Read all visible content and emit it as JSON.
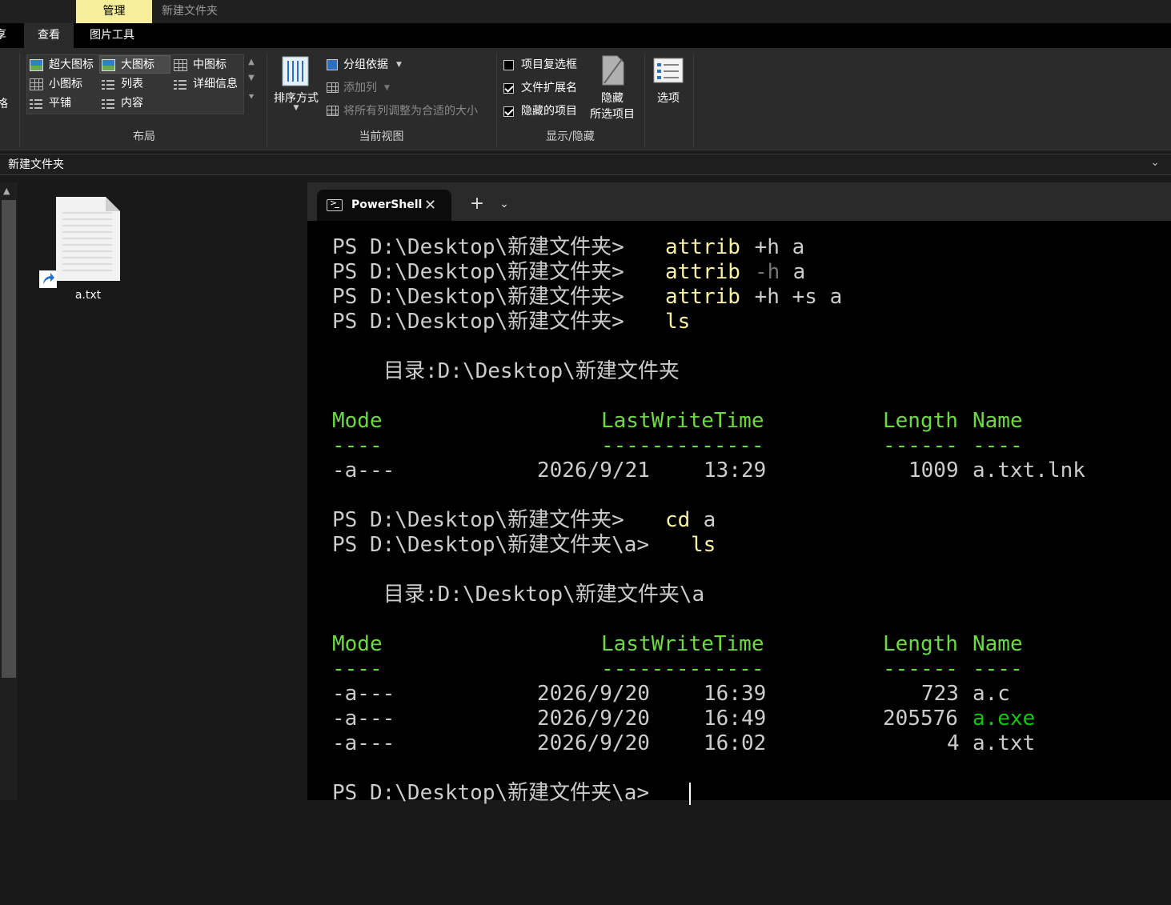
{
  "topbar": {
    "manage_tab": "管理",
    "folder_title": "新建文件夹"
  },
  "ribbon_tabs": {
    "share": "享",
    "view": "查看",
    "picture_tools": "图片工具"
  },
  "ribbon": {
    "clipped_left": "格",
    "layout": {
      "items": [
        "超大图标",
        "大图标",
        "中图标",
        "小图标",
        "列表",
        "详细信息",
        "平铺",
        "内容"
      ],
      "selected": "大图标",
      "group_label": "布局"
    },
    "current_view": {
      "sort_by": "排序方式",
      "group_by": "分组依据",
      "add_column": "添加列",
      "fit_columns": "将所有列调整为合适的大小",
      "group_label": "当前视图"
    },
    "show_hide": {
      "item_checkboxes": {
        "label": "项目复选框",
        "checked": false
      },
      "file_extensions": {
        "label": "文件扩展名",
        "checked": true
      },
      "hidden_items": {
        "label": "隐藏的项目",
        "checked": true
      },
      "hide_selected_line1": "隐藏",
      "hide_selected_line2": "所选项目",
      "group_label": "显示/隐藏"
    },
    "options": "选项"
  },
  "address": {
    "path": "新建文件夹"
  },
  "explorer": {
    "file_name": "a.txt"
  },
  "terminal": {
    "tab_title": "PowerShell",
    "lines": [
      {
        "prompt": "PS D:\\Desktop\\新建文件夹> ",
        "cmd": "attrib",
        "args": " +h a",
        "dim_part": ""
      },
      {
        "prompt": "PS D:\\Desktop\\新建文件夹> ",
        "cmd": "attrib",
        "args": " a",
        "dim_part": "-h"
      },
      {
        "prompt": "PS D:\\Desktop\\新建文件夹> ",
        "cmd": "attrib",
        "args": " +h +s a",
        "dim_part": ""
      },
      {
        "prompt": "PS D:\\Desktop\\新建文件夹> ",
        "cmd": "ls",
        "args": "",
        "dim_part": ""
      }
    ],
    "dir1": "目录:D:\\Desktop\\新建文件夹",
    "headers": {
      "mode": "Mode",
      "time": "LastWriteTime",
      "length": "Length",
      "name": "Name"
    },
    "underlines": {
      "mode": "----",
      "time": "-------------",
      "length": "------",
      "name": "----"
    },
    "listing1": [
      {
        "mode": "-a---",
        "date": "2026/9/21",
        "time": "13:29",
        "length": "1009",
        "name": "a.txt.lnk"
      }
    ],
    "cd_line": {
      "prompt": "PS D:\\Desktop\\新建文件夹> ",
      "cmd": "cd",
      "args": " a"
    },
    "ls_line": {
      "prompt": "PS D:\\Desktop\\新建文件夹\\a> ",
      "cmd": "ls"
    },
    "dir2": "目录:D:\\Desktop\\新建文件夹\\a",
    "listing2": [
      {
        "mode": "-a---",
        "date": "2026/9/20",
        "time": "16:39",
        "length": "723",
        "name": "a.c"
      },
      {
        "mode": "-a---",
        "date": "2026/9/20",
        "time": "16:49",
        "length": "205576",
        "name": "a.exe"
      },
      {
        "mode": "-a---",
        "date": "2026/9/20",
        "time": "16:02",
        "length": "4",
        "name": "a.txt"
      }
    ],
    "final_prompt": "PS D:\\Desktop\\新建文件夹\\a> "
  }
}
